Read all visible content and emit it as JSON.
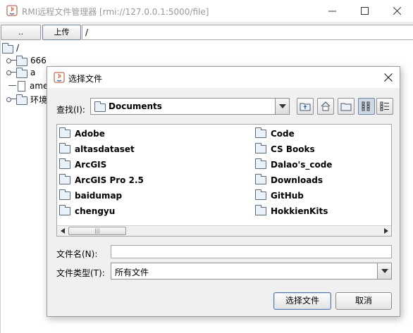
{
  "window": {
    "title": "RMI远程文件管理器 [rmi://127.0.0.1:5000/file]",
    "controls": {
      "minimize": "—",
      "maximize": "☐",
      "close": "✕"
    }
  },
  "toolbar": {
    "up_label": "..",
    "upload_label": "上传",
    "path_value": "/"
  },
  "tree": {
    "root": "/",
    "items": [
      {
        "label": "666",
        "type": "folder"
      },
      {
        "label": "a",
        "type": "folder"
      },
      {
        "label": "ame",
        "type": "file"
      },
      {
        "label": "环境",
        "type": "folder"
      }
    ]
  },
  "dialog": {
    "title": "选择文件",
    "look_in_label": "查找(I):",
    "look_in_value": "Documents",
    "toolbar_icons": [
      "up-folder-icon",
      "home-icon",
      "new-folder-icon",
      "list-view-icon",
      "details-view-icon"
    ],
    "files_col1": [
      "Adobe",
      "altasdataset",
      "ArcGIS",
      "ArcGIS Pro 2.5",
      "baidumap",
      "chengyu"
    ],
    "files_col2": [
      "Code",
      "CS Books",
      "Dalao's_code",
      "Downloads",
      "GitHub",
      "HokkienKits"
    ],
    "filename_label": "文件名(N):",
    "filename_value": "",
    "filetype_label": "文件类型(T):",
    "filetype_value": "所有文件",
    "approve_label": "选择文件",
    "cancel_label": "取消"
  },
  "colors": {
    "dialog_body": "#f0f0f0",
    "default_button_border": "#5a7aa6",
    "folder_fill": "#eaf1f8"
  }
}
